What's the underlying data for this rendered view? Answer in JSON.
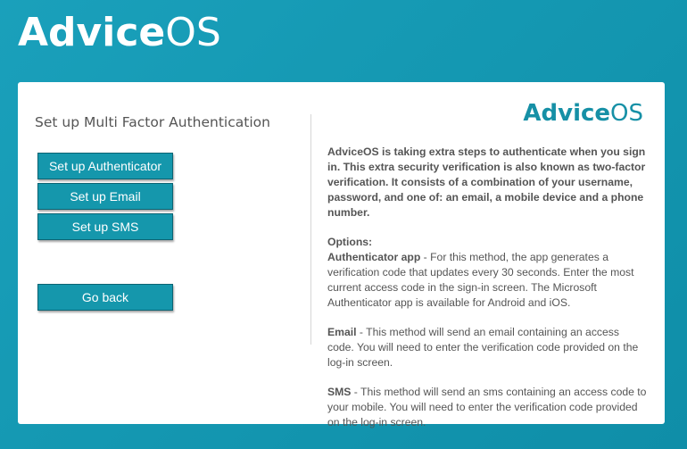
{
  "header": {
    "brand_bold": "Advice",
    "brand_light": "OS"
  },
  "left": {
    "title": "Set up Multi Factor Authentication",
    "buttons": {
      "authenticator": "Set up Authenticator",
      "email": "Set up Email",
      "sms": "Set up SMS",
      "back": "Go back"
    }
  },
  "right": {
    "logo_bold": "Advice",
    "logo_light": "OS",
    "intro": "AdviceOS is taking extra steps to authenticate when you sign in. This extra security verification is also known as two-factor verification. It consists of a combination of your username, password, and one of: an email, a mobile device and a phone number.",
    "options_heading": "Options:",
    "options": [
      {
        "label": "Authenticator app",
        "text": " - For this method, the app generates a verification code that updates every 30 seconds. Enter the most current access code in the sign-in screen. The Microsoft Authenticator app is available for Android and iOS."
      },
      {
        "label": "Email",
        "text": " - This method will send an email containing an access code. You will need to enter the verification code provided on the log-in screen."
      },
      {
        "label": "SMS",
        "text": " - This method will send an sms containing an access code to your mobile. You will need to enter the verification code provided on the log-in screen."
      }
    ]
  },
  "colors": {
    "background": "#1599b3",
    "button": "#1597ac",
    "logo_teal": "#1690a6"
  }
}
